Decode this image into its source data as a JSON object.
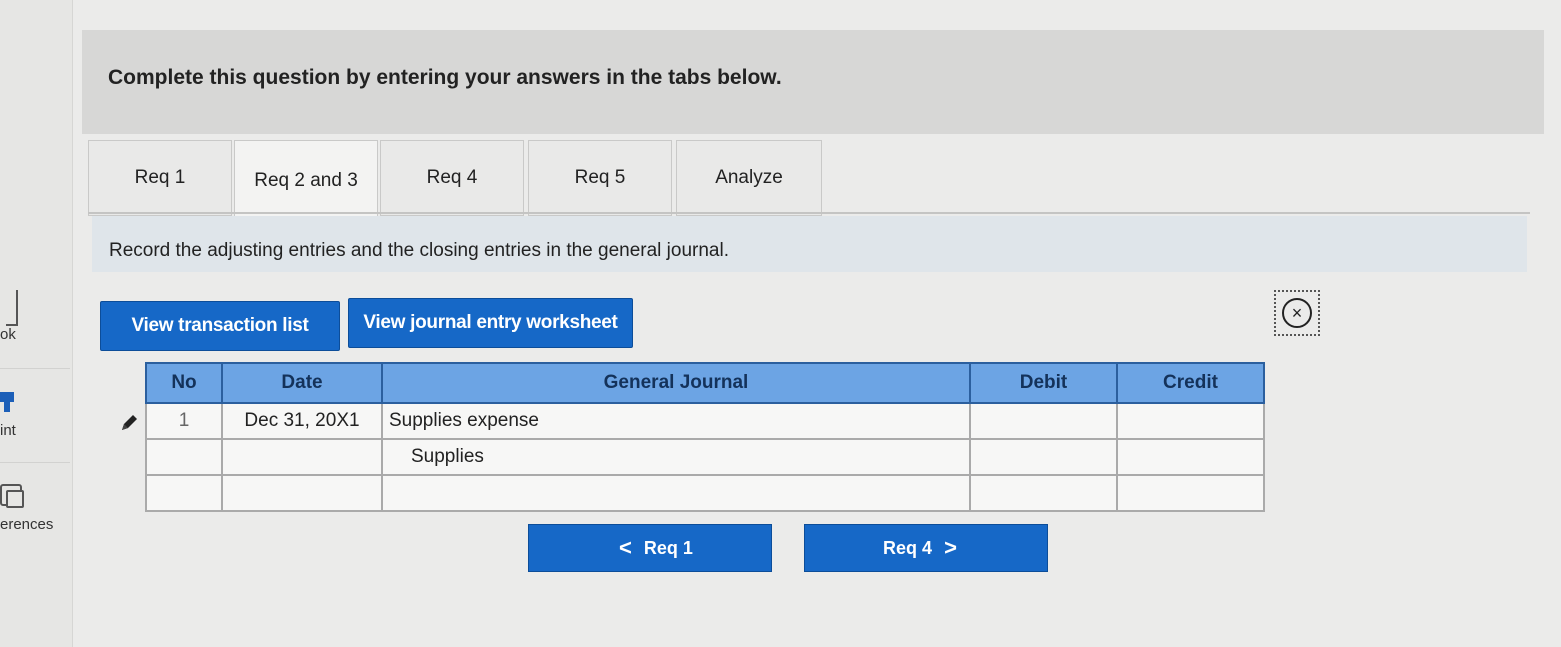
{
  "sidebar": {
    "items": [
      {
        "label": "ok",
        "icon": "bookmark-icon"
      },
      {
        "label": "int",
        "icon": "print-icon"
      },
      {
        "label": "erences",
        "icon": "references-icon"
      }
    ]
  },
  "banner": {
    "text": "Complete this question by entering your answers in the tabs below."
  },
  "tabs": [
    {
      "label": "Req 1"
    },
    {
      "label": "Req 2 and 3",
      "active": true
    },
    {
      "label": "Req 4"
    },
    {
      "label": "Req 5"
    },
    {
      "label": "Analyze"
    }
  ],
  "instruction": "Record the adjusting entries and the closing entries in the general journal.",
  "buttons": {
    "view_transactions": "View transaction list",
    "view_worksheet": "View journal entry worksheet"
  },
  "close_icon": "×",
  "journal": {
    "headers": [
      "No",
      "Date",
      "General Journal",
      "Debit",
      "Credit"
    ],
    "rows": [
      {
        "no": "1",
        "date": "Dec 31, 20X1",
        "account": "Supplies expense",
        "debit": "",
        "credit": ""
      },
      {
        "no": "",
        "date": "",
        "account": "Supplies",
        "debit": "",
        "credit": ""
      },
      {
        "no": "",
        "date": "",
        "account": "",
        "debit": "",
        "credit": ""
      }
    ]
  },
  "nav": {
    "prev_label": "Req 1",
    "next_label": "Req 4",
    "prev_glyph": "<",
    "next_glyph": ">"
  },
  "colors": {
    "accent": "#1668c7",
    "header_fill": "#6ca4e4"
  }
}
